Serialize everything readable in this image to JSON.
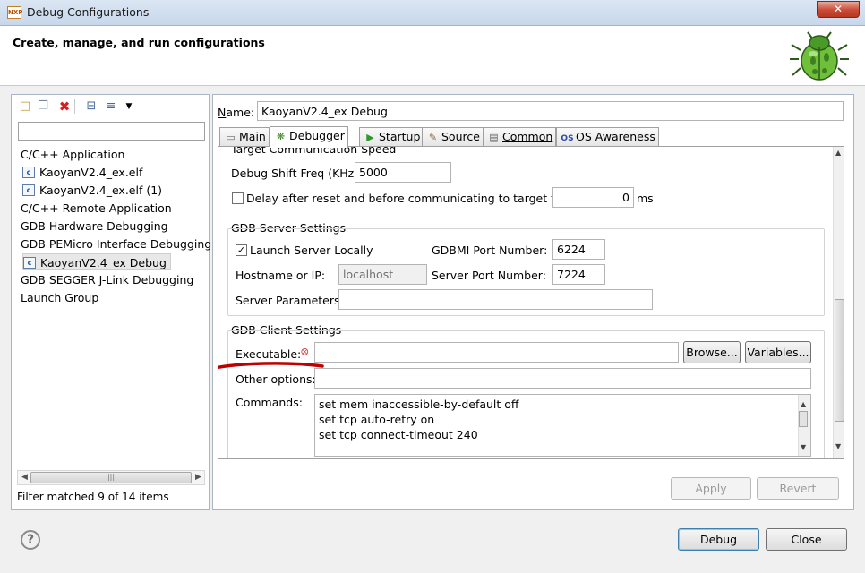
{
  "window": {
    "title": "Debug Configurations",
    "close_glyph": "✕",
    "app_icon_text": "NXP"
  },
  "header": {
    "title": "Create, manage, and run configurations"
  },
  "left": {
    "toolbar_icons": [
      "new-config-icon",
      "duplicate-icon",
      "delete-icon",
      "collapse-all-icon",
      "filter-icon",
      "dropdown-icon"
    ],
    "filter_value": "",
    "tree": [
      {
        "label": "C/C++ Application",
        "type": "category"
      },
      {
        "label": "KaoyanV2.4_ex.elf",
        "type": "config"
      },
      {
        "label": "KaoyanV2.4_ex.elf (1)",
        "type": "config"
      },
      {
        "label": "C/C++ Remote Application",
        "type": "category"
      },
      {
        "label": "GDB Hardware Debugging",
        "type": "category"
      },
      {
        "label": "GDB PEMicro Interface Debugging",
        "type": "category"
      },
      {
        "label": "KaoyanV2.4_ex Debug",
        "type": "config",
        "selected": true
      },
      {
        "label": "GDB SEGGER J-Link Debugging",
        "type": "category"
      },
      {
        "label": "Launch Group",
        "type": "category"
      }
    ],
    "status": "Filter matched 9 of 14 items"
  },
  "right": {
    "name_label": "Name:",
    "name_value": "KaoyanV2.4_ex Debug",
    "tabs": [
      {
        "label": "Main",
        "icon": "main-tab-icon"
      },
      {
        "label": "Debugger",
        "icon": "bug-icon",
        "active": true
      },
      {
        "label": "Startup",
        "icon": "run-icon"
      },
      {
        "label": "Source",
        "icon": "source-icon"
      },
      {
        "label": "Common",
        "icon": "common-icon"
      },
      {
        "label": "OS Awareness",
        "icon": "os-icon"
      }
    ],
    "speed": {
      "section_label": "Target Communication Speed",
      "shift_label": "Debug Shift Freq (KHz)",
      "shift_value": "5000",
      "delay_label": "Delay after reset and before communicating to target for",
      "delay_checked": false,
      "delay_value": "0",
      "delay_unit": "ms"
    },
    "server": {
      "title": "GDB Server Settings",
      "launch_label": "Launch Server Locally",
      "launch_checked": true,
      "gdbmi_label": "GDBMI Port Number:",
      "gdbmi_value": "6224",
      "host_label": "Hostname or IP:",
      "host_value": "localhost",
      "port_label": "Server Port Number:",
      "port_value": "7224",
      "params_label": "Server Parameters:",
      "params_value": ""
    },
    "client": {
      "title": "GDB Client Settings",
      "exec_label": "Executable:",
      "exec_value": "",
      "browse_label": "Browse...",
      "variables_label": "Variables...",
      "other_label": "Other options:",
      "other_value": "",
      "commands_label": "Commands:",
      "commands": [
        "set mem inaccessible-by-default off",
        "set tcp auto-retry on",
        "set tcp connect-timeout 240"
      ]
    },
    "apply_label": "Apply",
    "revert_label": "Revert"
  },
  "footer": {
    "debug_label": "Debug",
    "close_label": "Close",
    "help_glyph": "?"
  },
  "colors": {
    "annotation": "#c00000",
    "accent": "#3c7fb1"
  }
}
